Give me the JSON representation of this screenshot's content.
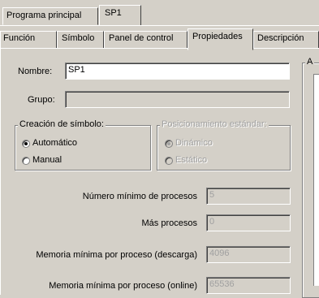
{
  "doc_tabs": [
    {
      "label": "Programa principal",
      "active": false
    },
    {
      "label": "SP1",
      "active": true
    }
  ],
  "prop_tabs": [
    {
      "label": "Función"
    },
    {
      "label": "Símbolo"
    },
    {
      "label": "Panel de control"
    },
    {
      "label": "Propiedades",
      "active": true
    },
    {
      "label": "Descripción"
    }
  ],
  "form": {
    "nombre_label": "Nombre:",
    "nombre_value": "SP1",
    "grupo_label": "Grupo:",
    "grupo_value": ""
  },
  "creacion": {
    "legend": "Creación de símbolo:",
    "options": [
      {
        "label": "Automático",
        "checked": true
      },
      {
        "label": "Manual",
        "checked": false
      }
    ]
  },
  "posicionamiento": {
    "legend": "Posicionamiento estándar:",
    "options": [
      {
        "label": "Dinámico",
        "checked": true
      },
      {
        "label": "Estático",
        "checked": false
      }
    ]
  },
  "params": [
    {
      "label": "Número mínimo de procesos",
      "value": "5"
    },
    {
      "label": "Más procesos",
      "value": "0"
    },
    {
      "label": "Memoria mínima por proceso (descarga)",
      "value": "4096"
    },
    {
      "label": "Memoria mínima por proceso (online)",
      "value": "65536"
    }
  ],
  "right_group_legend": "A"
}
